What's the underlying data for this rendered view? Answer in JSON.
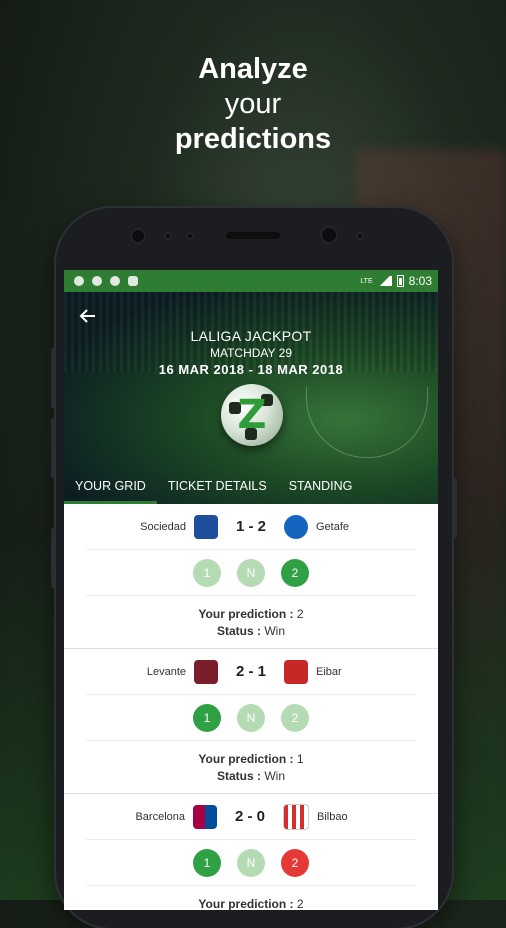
{
  "headline": {
    "line1": "Analyze",
    "line2": "your",
    "line3": "predictions"
  },
  "status_bar": {
    "time": "8:03",
    "network": "LTE"
  },
  "header": {
    "title": "LALIGA JACKPOT",
    "subtitle": "MATCHDAY 29",
    "dates": "16 MAR 2018 - 18 MAR 2018"
  },
  "tabs": [
    {
      "label": "YOUR GRID",
      "active": true
    },
    {
      "label": "TICKET DETAILS",
      "active": false
    },
    {
      "label": "STANDING",
      "active": false
    }
  ],
  "labels": {
    "prediction": "Your prediction :",
    "status": "Status :"
  },
  "matches": [
    {
      "home": "Sociedad",
      "away": "Getafe",
      "score": "1 - 2",
      "home_color": "#1d4f9c",
      "away_color": "#1565c0",
      "picks": [
        {
          "label": "1",
          "state": "light"
        },
        {
          "label": "N",
          "state": "light"
        },
        {
          "label": "2",
          "state": "green"
        }
      ],
      "prediction": "2",
      "status": "Win"
    },
    {
      "home": "Levante",
      "away": "Eibar",
      "score": "2 - 1",
      "home_color": "#7b1e2b",
      "away_color": "#c62828",
      "picks": [
        {
          "label": "1",
          "state": "green"
        },
        {
          "label": "N",
          "state": "light"
        },
        {
          "label": "2",
          "state": "light"
        }
      ],
      "prediction": "1",
      "status": "Win"
    },
    {
      "home": "Barcelona",
      "away": "Bilbao",
      "score": "2 - 0",
      "home_color": "#a50044",
      "away_color": "#d32f2f",
      "picks": [
        {
          "label": "1",
          "state": "green"
        },
        {
          "label": "N",
          "state": "light"
        },
        {
          "label": "2",
          "state": "red"
        }
      ],
      "prediction": "2",
      "status": ""
    }
  ]
}
